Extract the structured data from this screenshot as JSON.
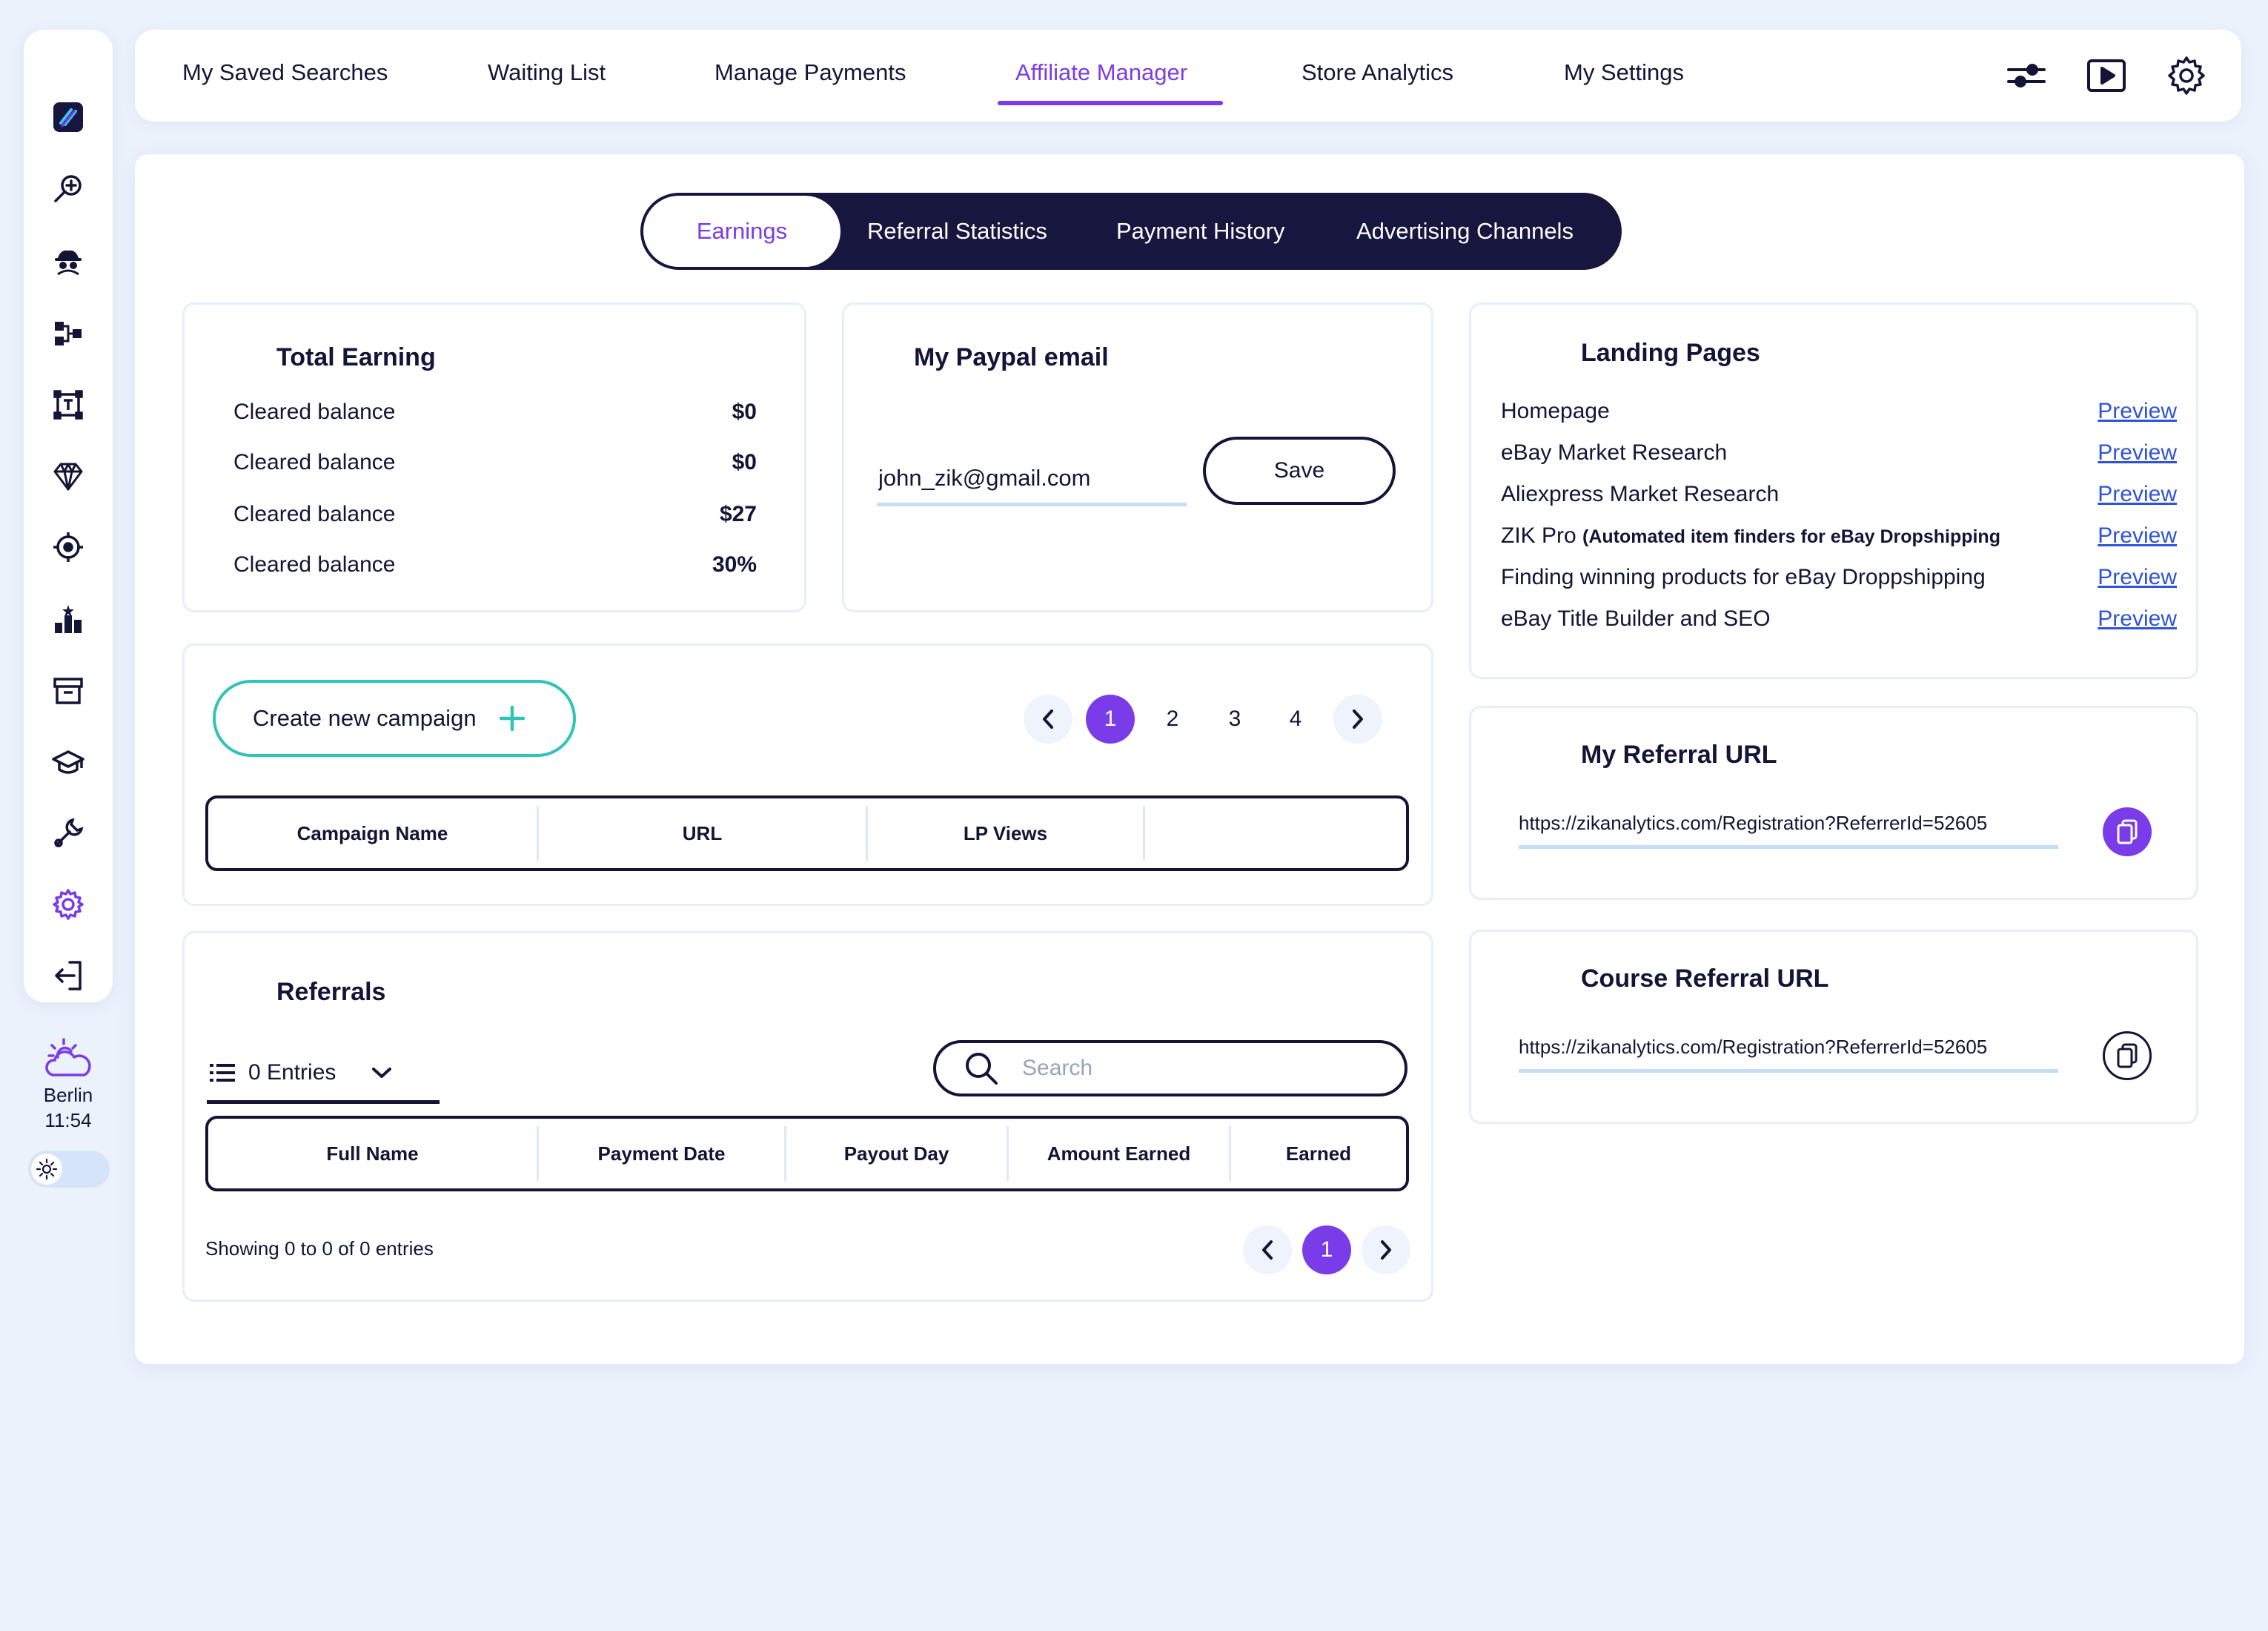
{
  "topnav": {
    "tabs": [
      {
        "label": "My Saved Searches"
      },
      {
        "label": "Waiting List"
      },
      {
        "label": "Manage Payments"
      },
      {
        "label": "Affiliate Manager"
      },
      {
        "label": "Store Analytics"
      },
      {
        "label": "My Settings"
      }
    ],
    "active_tab": "Affiliate Manager",
    "icons": [
      "sliders-icon",
      "video-play-icon",
      "gear-icon"
    ]
  },
  "sidebar": {
    "icons": [
      "logo-icon",
      "search-plus-icon",
      "spy-icon",
      "flow-icon",
      "text-frame-icon",
      "diamond-icon",
      "target-icon",
      "leaderboard-icon",
      "archive-icon",
      "graduation-cap-icon",
      "wrench-icon",
      "settings-icon",
      "logout-icon"
    ],
    "weather": {
      "city": "Berlin",
      "time": "11:54",
      "icon": "cloud-sun-icon"
    }
  },
  "subtabs": [
    {
      "label": "Earnings"
    },
    {
      "label": "Referral Statistics"
    },
    {
      "label": "Payment History"
    },
    {
      "label": "Advertising Channels"
    }
  ],
  "total_earning": {
    "title": "Total Earning",
    "rows": [
      {
        "label": "Cleared balance",
        "value": "$0"
      },
      {
        "label": "Cleared balance",
        "value": "$0"
      },
      {
        "label": "Cleared balance",
        "value": "$27"
      },
      {
        "label": "Cleared balance",
        "value": "30%"
      }
    ]
  },
  "paypal": {
    "title": "My Paypal email",
    "email": "john_zik@gmail.com",
    "save_label": "Save"
  },
  "landing_pages": {
    "title": "Landing Pages",
    "items": [
      {
        "name": "Homepage",
        "sub": "",
        "link": "Preview"
      },
      {
        "name": "eBay Market Research",
        "sub": "",
        "link": "Preview"
      },
      {
        "name": "Aliexpress Market Research",
        "sub": "",
        "link": "Preview"
      },
      {
        "name": "ZIK Pro",
        "sub": "(Automated item finders for eBay Dropshipping",
        "link": "Preview"
      },
      {
        "name": "Finding winning products for eBay Droppshipping",
        "sub": "",
        "link": "Preview"
      },
      {
        "name": "eBay Title Builder and SEO",
        "sub": "",
        "link": "Preview"
      }
    ]
  },
  "campaigns": {
    "create_label": "Create new campaign",
    "pages": [
      "1",
      "2",
      "3",
      "4"
    ],
    "active_page": "1",
    "columns": [
      "Campaign Name",
      "URL",
      "LP Views",
      ""
    ]
  },
  "referral_url": {
    "title": "My Referral URL",
    "url": "https://zikanalytics.com/Registration?ReferrerId=52605"
  },
  "course_referral_url": {
    "title": "Course Referral URL",
    "url": "https://zikanalytics.com/Registration?ReferrerId=52605"
  },
  "referrals": {
    "title": "Referrals",
    "entries_label": "0 Entries",
    "search_placeholder": "Search",
    "columns": [
      "Full Name",
      "Payment Date",
      "Payout Day",
      "Amount Earned",
      "Earned"
    ],
    "showing": "Showing 0 to 0 of 0 entries",
    "active_page": "1"
  },
  "colors": {
    "accent": "#7a3ce8",
    "dark": "#17163f",
    "teal": "#2ec4b6",
    "link": "#2f54d6",
    "background": "#ebf2fc"
  }
}
